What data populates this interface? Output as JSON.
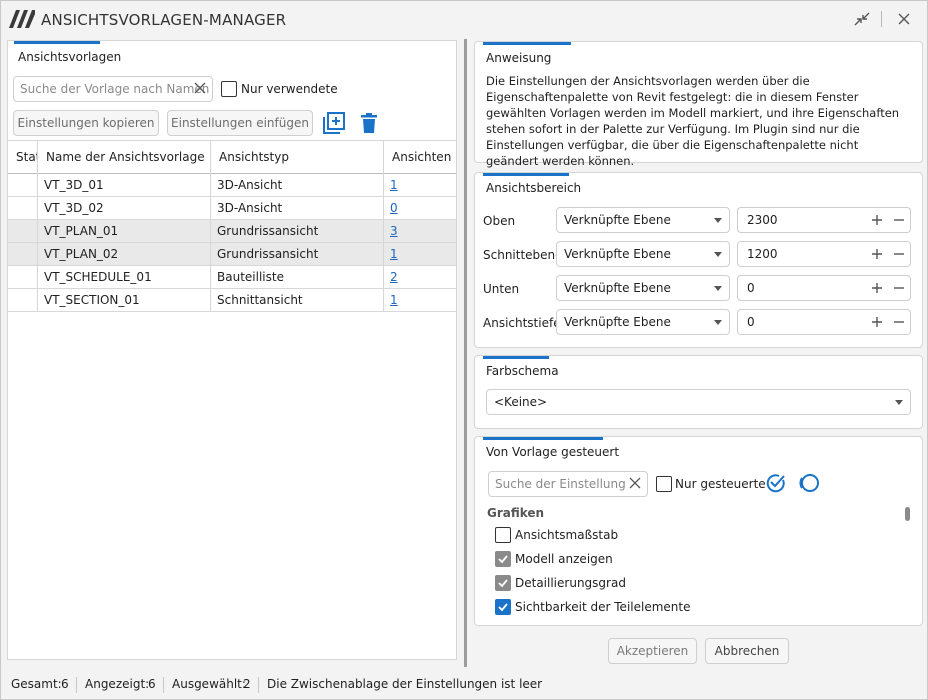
{
  "window": {
    "title": "ANSICHTSVORLAGEN-MANAGER"
  },
  "left": {
    "group_title": "Ansichtsvorlagen",
    "search_placeholder": "Suche der Vorlage nach Namen",
    "only_used_label": "Nur verwendete",
    "copy_settings_label": "Einstellungen kopieren",
    "paste_settings_label": "Einstellungen einfügen",
    "table": {
      "columns": [
        "Status",
        "Name der Ansichtsvorlage",
        "Ansichtstyp",
        "Ansichten"
      ],
      "rows": [
        {
          "status": "",
          "name": "VT_3D_01",
          "type": "3D-Ansicht",
          "views": "1",
          "selected": false
        },
        {
          "status": "",
          "name": "VT_3D_02",
          "type": "3D-Ansicht",
          "views": "0",
          "selected": false
        },
        {
          "status": "",
          "name": "VT_PLAN_01",
          "type": "Grundrissansicht",
          "views": "3",
          "selected": true
        },
        {
          "status": "",
          "name": "VT_PLAN_02",
          "type": "Grundrissansicht",
          "views": "1",
          "selected": true
        },
        {
          "status": "",
          "name": "VT_SCHEDULE_01",
          "type": "Bauteilliste",
          "views": "2",
          "selected": false
        },
        {
          "status": "",
          "name": "VT_SECTION_01",
          "type": "Schnittansicht",
          "views": "1",
          "selected": false
        }
      ]
    }
  },
  "instruction": {
    "title": "Anweisung",
    "text": "Die Einstellungen der Ansichtsvorlagen werden über die Eigenschaftenpalette von Revit festgelegt: die in diesem Fenster gewählten Vorlagen werden im Modell markiert, und ihre Eigenschaften stehen sofort in der Palette zur Verfügung. Im Plugin sind nur die Einstellungen verfügbar, die über die Eigenschaftenpalette nicht geändert werden können."
  },
  "view_range": {
    "title": "Ansichtsbereich",
    "rows": [
      {
        "label": "Oben",
        "level": "Verknüpfte Ebene",
        "offset": "2300"
      },
      {
        "label": "Schnittebene",
        "level": "Verknüpfte Ebene",
        "offset": "1200"
      },
      {
        "label": "Unten",
        "level": "Verknüpfte Ebene",
        "offset": "0"
      },
      {
        "label": "Ansichtstiefe",
        "level": "Verknüpfte Ebene",
        "offset": "0"
      }
    ]
  },
  "color_scheme": {
    "title": "Farbschema",
    "value": "<Keine>"
  },
  "controlled": {
    "title": "Von Vorlage gesteuert",
    "search_placeholder": "Suche der Einstellung",
    "only_controlled_label": "Nur gesteuerte",
    "section": "Grafiken",
    "items": [
      {
        "label": "Ansichtsmaßstab",
        "state": "unchecked"
      },
      {
        "label": "Modell anzeigen",
        "state": "checked-grey"
      },
      {
        "label": "Detaillierungsgrad",
        "state": "checked-grey"
      },
      {
        "label": "Sichtbarkeit der Teilelemente",
        "state": "checked-blue"
      }
    ]
  },
  "footer": {
    "accept_label": "Akzeptieren",
    "cancel_label": "Abbrechen"
  },
  "status": {
    "total_label": "Gesamt:",
    "total_value": "6",
    "shown_label": "Angezeigt:",
    "shown_value": "6",
    "selected_label": "Ausgewählt:",
    "selected_value": "2",
    "clipboard_text": "Die Zwischenablage der Einstellungen ist leer"
  },
  "colors": {
    "accent": "#1a73c9",
    "link": "#1a66c0",
    "selected_row": "#e9e9e9"
  }
}
